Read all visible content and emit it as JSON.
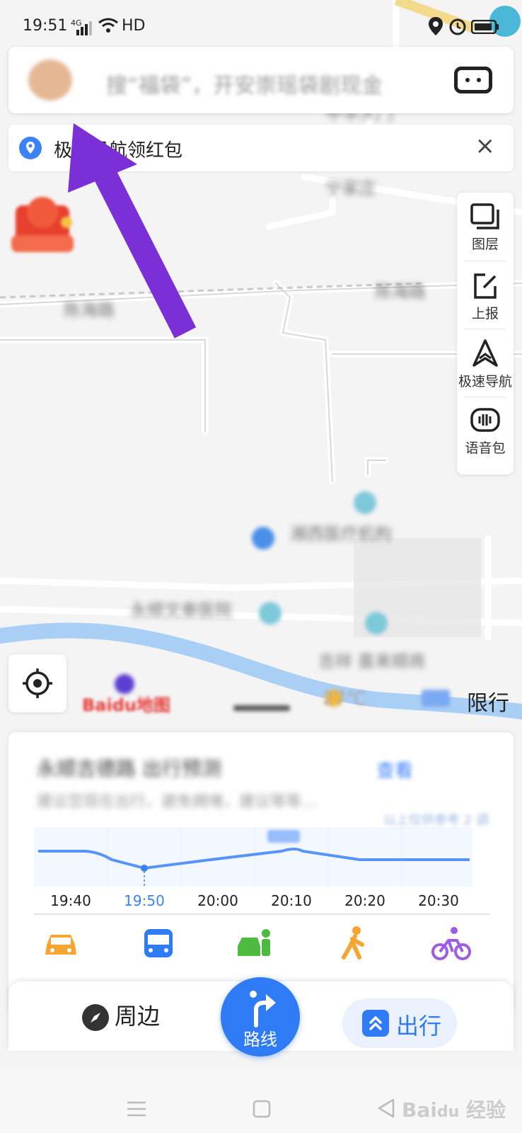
{
  "status_bar": {
    "time": "19:51",
    "network": "4G",
    "hd": "HD"
  },
  "search": {
    "placeholder": "搜“福袋”，开安崇瑶袋剧现金"
  },
  "notice": {
    "text": "极速导航领红包"
  },
  "envelope": {
    "label": "开红包"
  },
  "tools": [
    {
      "label": "图层",
      "icon": "layers-icon"
    },
    {
      "label": "上报",
      "icon": "report-icon"
    },
    {
      "label": "极速导航",
      "icon": "navigation-icon"
    },
    {
      "label": "语音包",
      "icon": "voice-pack-icon"
    }
  ],
  "map": {
    "limit_label": "限行",
    "weather": "27℃",
    "baidu_logo": "Baidu地图"
  },
  "card": {
    "title": "永顺吉德路 出行预测",
    "subtitle": "建议您现在出行，避免拥堵，建议等等…",
    "view_label": "查看",
    "timeline": [
      "19:40",
      "19:50",
      "20:00",
      "20:10",
      "20:20",
      "20:30"
    ],
    "current_time": "19:50",
    "modes": [
      "car",
      "bus",
      "taxi",
      "walk",
      "bike"
    ]
  },
  "bottom": {
    "nearby_label": "周边",
    "route_label": "路线",
    "travel_label": "出行"
  },
  "colors": {
    "accent": "#2f7bf5",
    "arrow": "#7b2fd6",
    "river": "#9cc8f3"
  }
}
